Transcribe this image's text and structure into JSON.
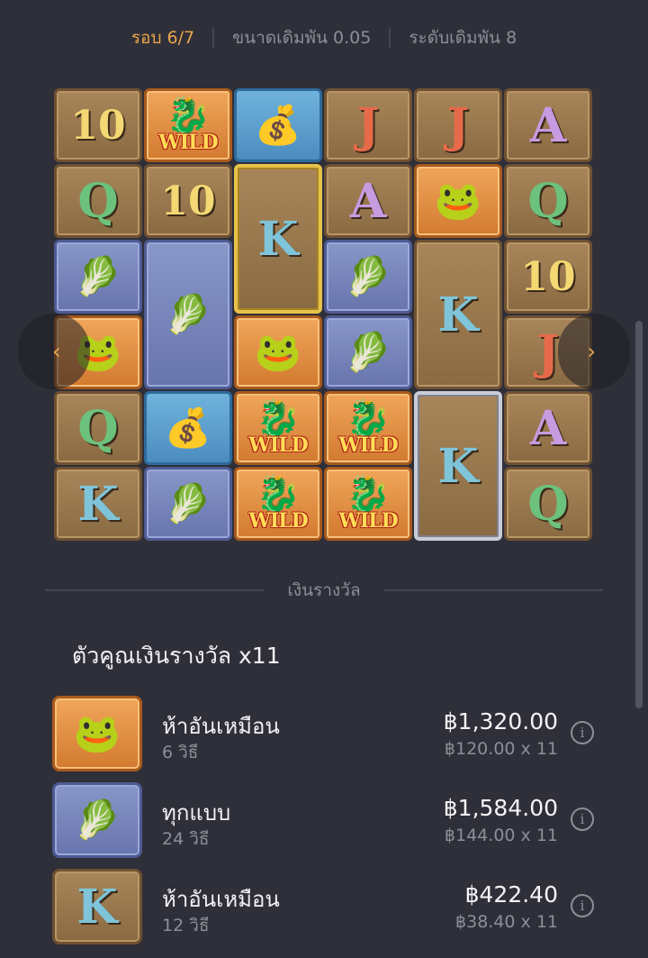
{
  "topbar": {
    "round": "รอบ 6/7",
    "bet_size": "ขนาดเดิมพัน 0.05",
    "bet_level": "ระดับเดิมพัน 8"
  },
  "grid": {
    "wild_label": "WILD",
    "tiles": [
      {
        "col": 0,
        "row": 0,
        "kind": "letter",
        "text": "10",
        "bg": "brown"
      },
      {
        "col": 1,
        "row": 0,
        "kind": "wild",
        "bg": "orange"
      },
      {
        "col": 2,
        "row": 0,
        "kind": "pouch",
        "bg": "skyblue"
      },
      {
        "col": 3,
        "row": 0,
        "kind": "letter",
        "text": "J",
        "bg": "brown"
      },
      {
        "col": 4,
        "row": 0,
        "kind": "letter",
        "text": "J",
        "bg": "brown"
      },
      {
        "col": 5,
        "row": 0,
        "kind": "letter",
        "text": "A",
        "bg": "brown"
      },
      {
        "col": 0,
        "row": 1,
        "kind": "letter",
        "text": "Q",
        "bg": "brown"
      },
      {
        "col": 1,
        "row": 1,
        "kind": "letter",
        "text": "10",
        "bg": "brown"
      },
      {
        "col": 2,
        "row": 1,
        "kind": "letter",
        "text": "K",
        "bg": "gold-frame",
        "span": 2
      },
      {
        "col": 3,
        "row": 1,
        "kind": "letter",
        "text": "A",
        "bg": "brown"
      },
      {
        "col": 4,
        "row": 1,
        "kind": "toad",
        "bg": "orange"
      },
      {
        "col": 5,
        "row": 1,
        "kind": "letter",
        "text": "Q",
        "bg": "brown"
      },
      {
        "col": 0,
        "row": 2,
        "kind": "cabbage",
        "bg": "blue"
      },
      {
        "col": 1,
        "row": 2,
        "kind": "cabbage",
        "bg": "blue",
        "span": 2
      },
      {
        "col": 3,
        "row": 2,
        "kind": "cabbage",
        "bg": "blue"
      },
      {
        "col": 4,
        "row": 2,
        "kind": "letter",
        "text": "K",
        "bg": "brown",
        "span": 2
      },
      {
        "col": 5,
        "row": 2,
        "kind": "letter",
        "text": "10",
        "bg": "brown"
      },
      {
        "col": 0,
        "row": 3,
        "kind": "toad",
        "bg": "orange"
      },
      {
        "col": 2,
        "row": 3,
        "kind": "toad",
        "bg": "orange"
      },
      {
        "col": 3,
        "row": 3,
        "kind": "cabbage",
        "bg": "blue"
      },
      {
        "col": 5,
        "row": 3,
        "kind": "letter",
        "text": "J",
        "bg": "brown"
      },
      {
        "col": 0,
        "row": 4,
        "kind": "letter",
        "text": "Q",
        "bg": "brown"
      },
      {
        "col": 1,
        "row": 4,
        "kind": "pouch",
        "bg": "skyblue"
      },
      {
        "col": 2,
        "row": 4,
        "kind": "wild",
        "bg": "orange"
      },
      {
        "col": 3,
        "row": 4,
        "kind": "wild",
        "bg": "orange"
      },
      {
        "col": 4,
        "row": 4,
        "kind": "letter",
        "text": "K",
        "bg": "silver-frame",
        "span": 2
      },
      {
        "col": 5,
        "row": 4,
        "kind": "letter",
        "text": "A",
        "bg": "brown"
      },
      {
        "col": 0,
        "row": 5,
        "kind": "letter",
        "text": "K",
        "bg": "brown"
      },
      {
        "col": 1,
        "row": 5,
        "kind": "cabbage",
        "bg": "blue"
      },
      {
        "col": 2,
        "row": 5,
        "kind": "wild",
        "bg": "orange"
      },
      {
        "col": 3,
        "row": 5,
        "kind": "wild",
        "bg": "orange"
      },
      {
        "col": 5,
        "row": 5,
        "kind": "letter",
        "text": "Q",
        "bg": "brown"
      }
    ]
  },
  "nav": {
    "prev_icon": "chevron-left-icon",
    "next_icon": "chevron-right-icon",
    "prev_glyph": "‹",
    "next_glyph": "›"
  },
  "payout": {
    "section_label": "เงินรางวัล",
    "multiplier_label": "ตัวคูณเงินรางวัล x11",
    "rows": [
      {
        "symbol": "toad",
        "name": "ห้าอันเหมือน",
        "ways": "6 วิธี",
        "amount": "฿1,320.00",
        "calc": "฿120.00 x 11"
      },
      {
        "symbol": "cabbage",
        "name": "ทุกแบบ",
        "ways": "24 วิธี",
        "amount": "฿1,584.00",
        "calc": "฿144.00 x 11"
      },
      {
        "symbol": "K",
        "name": "ห้าอันเหมือน",
        "ways": "12 วิธี",
        "amount": "฿422.40",
        "calc": "฿38.40 x 11"
      }
    ],
    "info_glyph": "i"
  },
  "colors": {
    "accent": "#e8a64a",
    "background": "#2f2f3a"
  }
}
